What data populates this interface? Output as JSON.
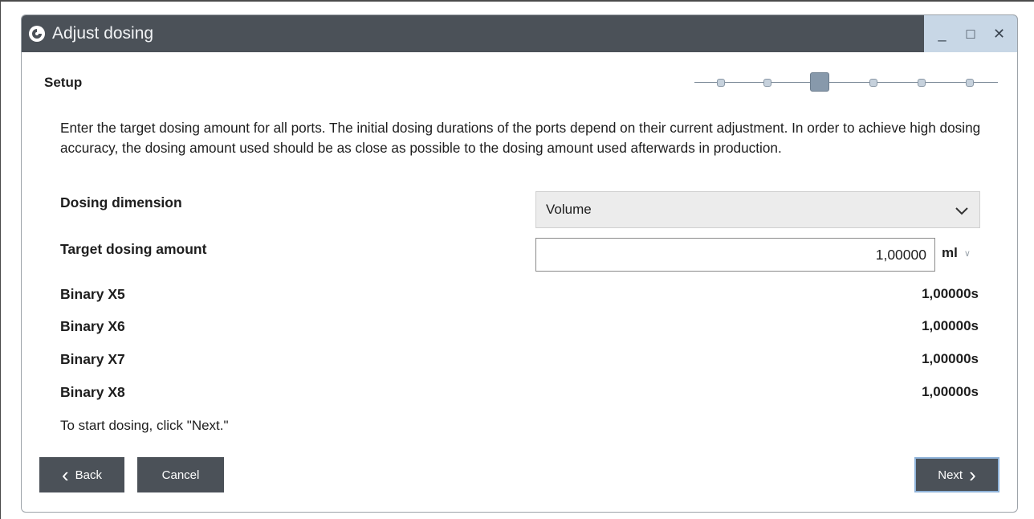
{
  "window": {
    "title": "Adjust dosing",
    "controls": {
      "minimize": "_",
      "maximize": "□",
      "close": "✕"
    }
  },
  "step": {
    "title": "Setup",
    "total_steps": 6,
    "current_step": 3
  },
  "intro": "Enter the target dosing amount for all ports. The initial dosing durations of the ports depend on their current adjustment. In order to achieve high dosing accuracy, the dosing amount used should be as close as possible to the dosing amount used afterwards in production.",
  "form": {
    "dimension_label": "Dosing dimension",
    "dimension_value": "Volume",
    "amount_label": "Target dosing amount",
    "amount_value": "1,00000",
    "amount_unit": "ml"
  },
  "ports": [
    {
      "label": "Binary X5",
      "value": "1,00000s"
    },
    {
      "label": "Binary X6",
      "value": "1,00000s"
    },
    {
      "label": "Binary X7",
      "value": "1,00000s"
    },
    {
      "label": "Binary X8",
      "value": "1,00000s"
    }
  ],
  "hint": "To start dosing, click \"Next.\"",
  "buttons": {
    "back": "Back",
    "cancel": "Cancel",
    "next": "Next"
  },
  "icons": {
    "app": "app-logo-icon",
    "select": "chevron-down-icon",
    "back": "chevron-left-icon",
    "next": "chevron-right-icon"
  },
  "colors": {
    "titlebar": "#4b5158",
    "window_controls": "#c8d7e6",
    "button": "#4b5158",
    "next_border": "#8fb3d9"
  }
}
